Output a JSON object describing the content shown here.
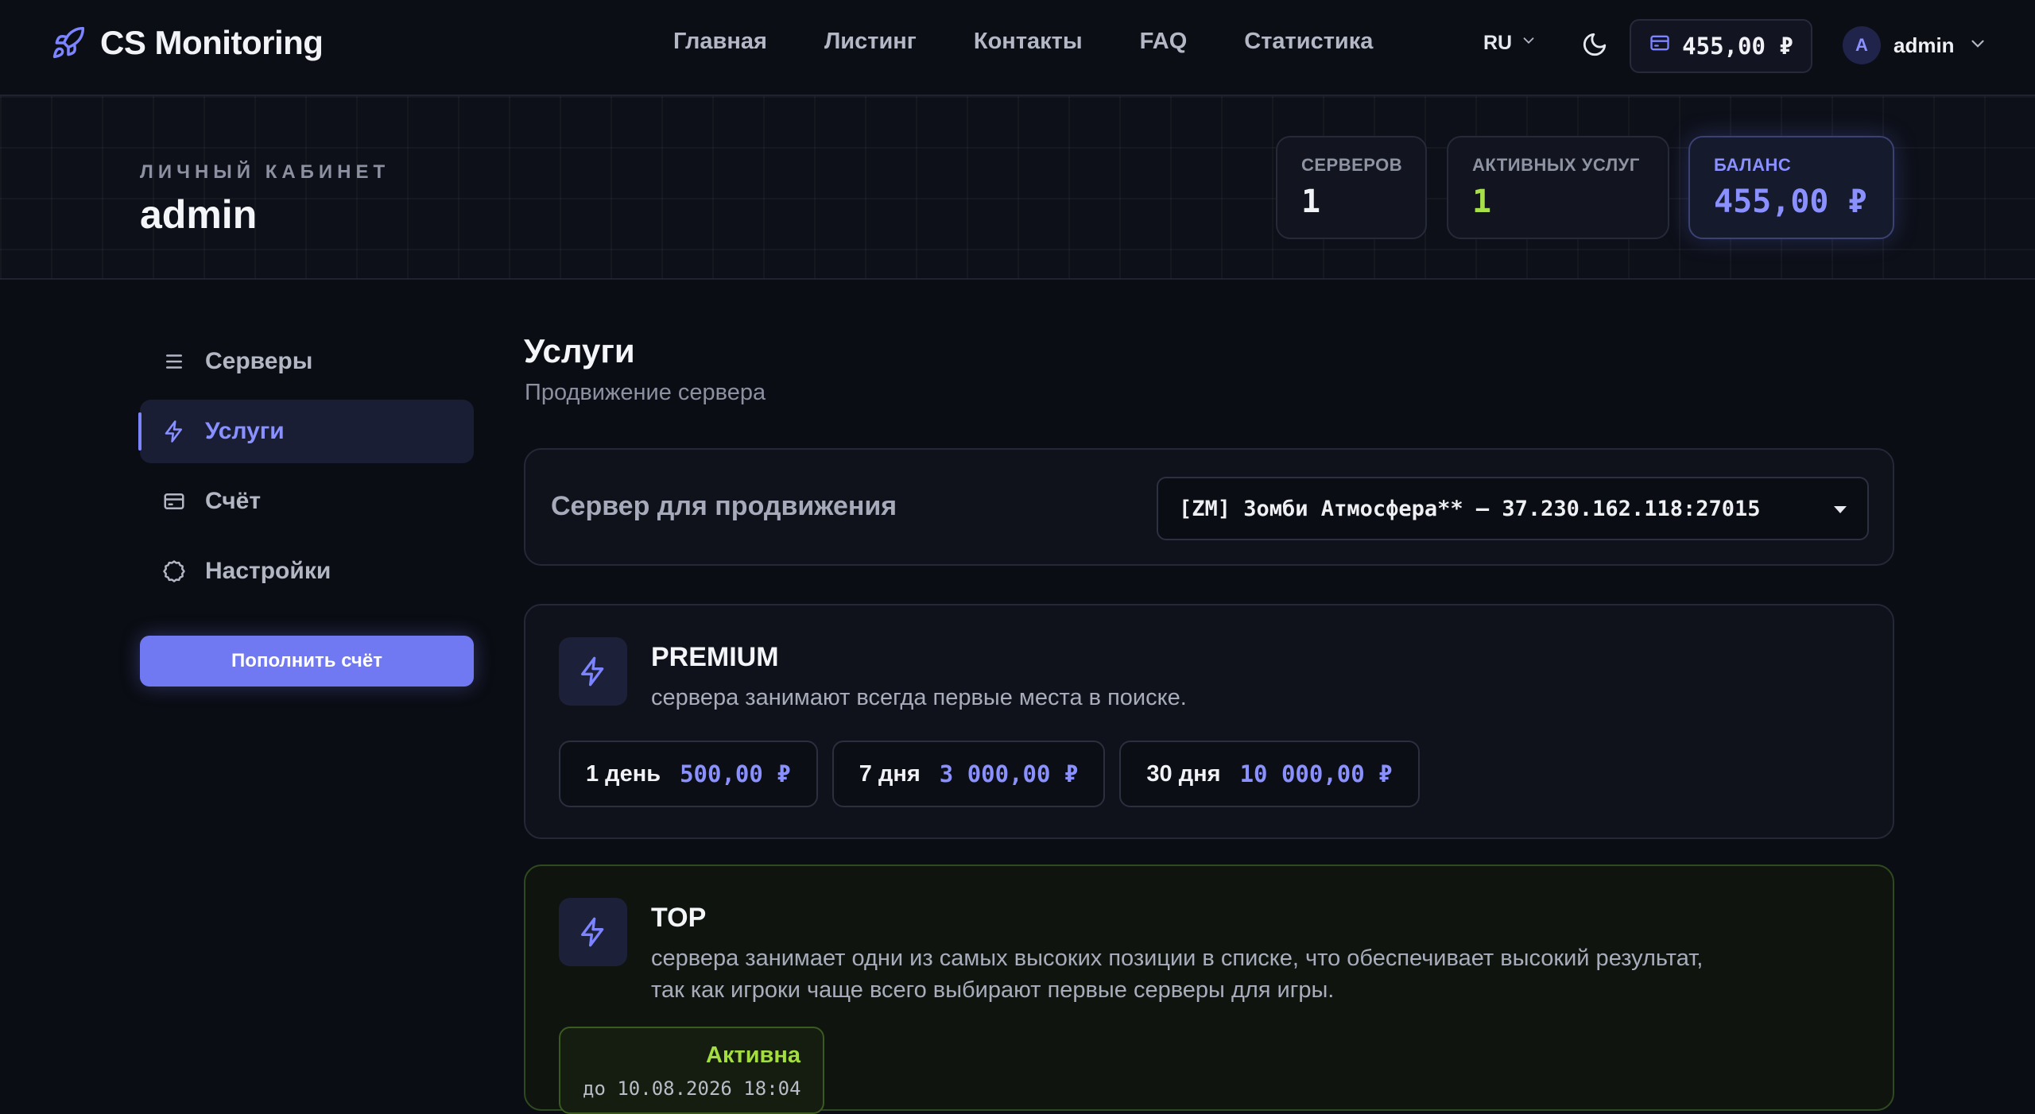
{
  "brand": {
    "name": "CS Monitoring",
    "icon": "rocket-icon"
  },
  "nav": {
    "items": [
      {
        "label": "Главная"
      },
      {
        "label": "Листинг"
      },
      {
        "label": "Контакты"
      },
      {
        "label": "FAQ"
      },
      {
        "label": "Статистика"
      }
    ]
  },
  "header": {
    "language": "RU",
    "balance": "455,00 ₽",
    "user_initial": "A",
    "user_name": "admin"
  },
  "hero": {
    "kicker": "ЛИЧНЫЙ КАБИНЕТ",
    "title": "admin",
    "stats": {
      "servers": {
        "label": "СЕРВЕРОВ",
        "value": "1"
      },
      "services": {
        "label": "АКТИВНЫХ УСЛУГ",
        "value": "1"
      },
      "balance": {
        "label": "БАЛАНС",
        "value": "455,00 ₽"
      }
    }
  },
  "sidebar": {
    "items": [
      {
        "label": "Серверы",
        "icon": "list-icon"
      },
      {
        "label": "Услуги",
        "icon": "lightning-icon",
        "active": true
      },
      {
        "label": "Счёт",
        "icon": "card-icon"
      },
      {
        "label": "Настройки",
        "icon": "gear-icon"
      }
    ],
    "topup_label": "Пополнить счёт"
  },
  "main": {
    "title": "Услуги",
    "subtitle": "Продвижение сервера",
    "server_picker": {
      "label": "Сервер для продвижения",
      "selected": "[ZM] Зомби Атмосфера** — 37.230.162.118:27015"
    },
    "services": {
      "premium": {
        "name": "PREMIUM",
        "description": "сервера занимают всегда первые места в поиске.",
        "prices": [
          {
            "period": "1 день",
            "amount": "500,00 ₽"
          },
          {
            "period": "7 дня",
            "amount": "3 000,00 ₽"
          },
          {
            "period": "30 дня",
            "amount": "10 000,00 ₽"
          }
        ]
      },
      "top": {
        "name": "TOP",
        "description_line1": "сервера занимает одни из самых высоких позиции в списке, что обеспечивает высокий результат,",
        "description_line2": "так как игроки чаще всего выбирают первые серверы для игры.",
        "status": "Активна",
        "until": "до 10.08.2026 18:04"
      }
    }
  },
  "colors": {
    "accent": "#7c84ff",
    "active_green": "#a4dd3f",
    "background": "#0b0d14"
  }
}
